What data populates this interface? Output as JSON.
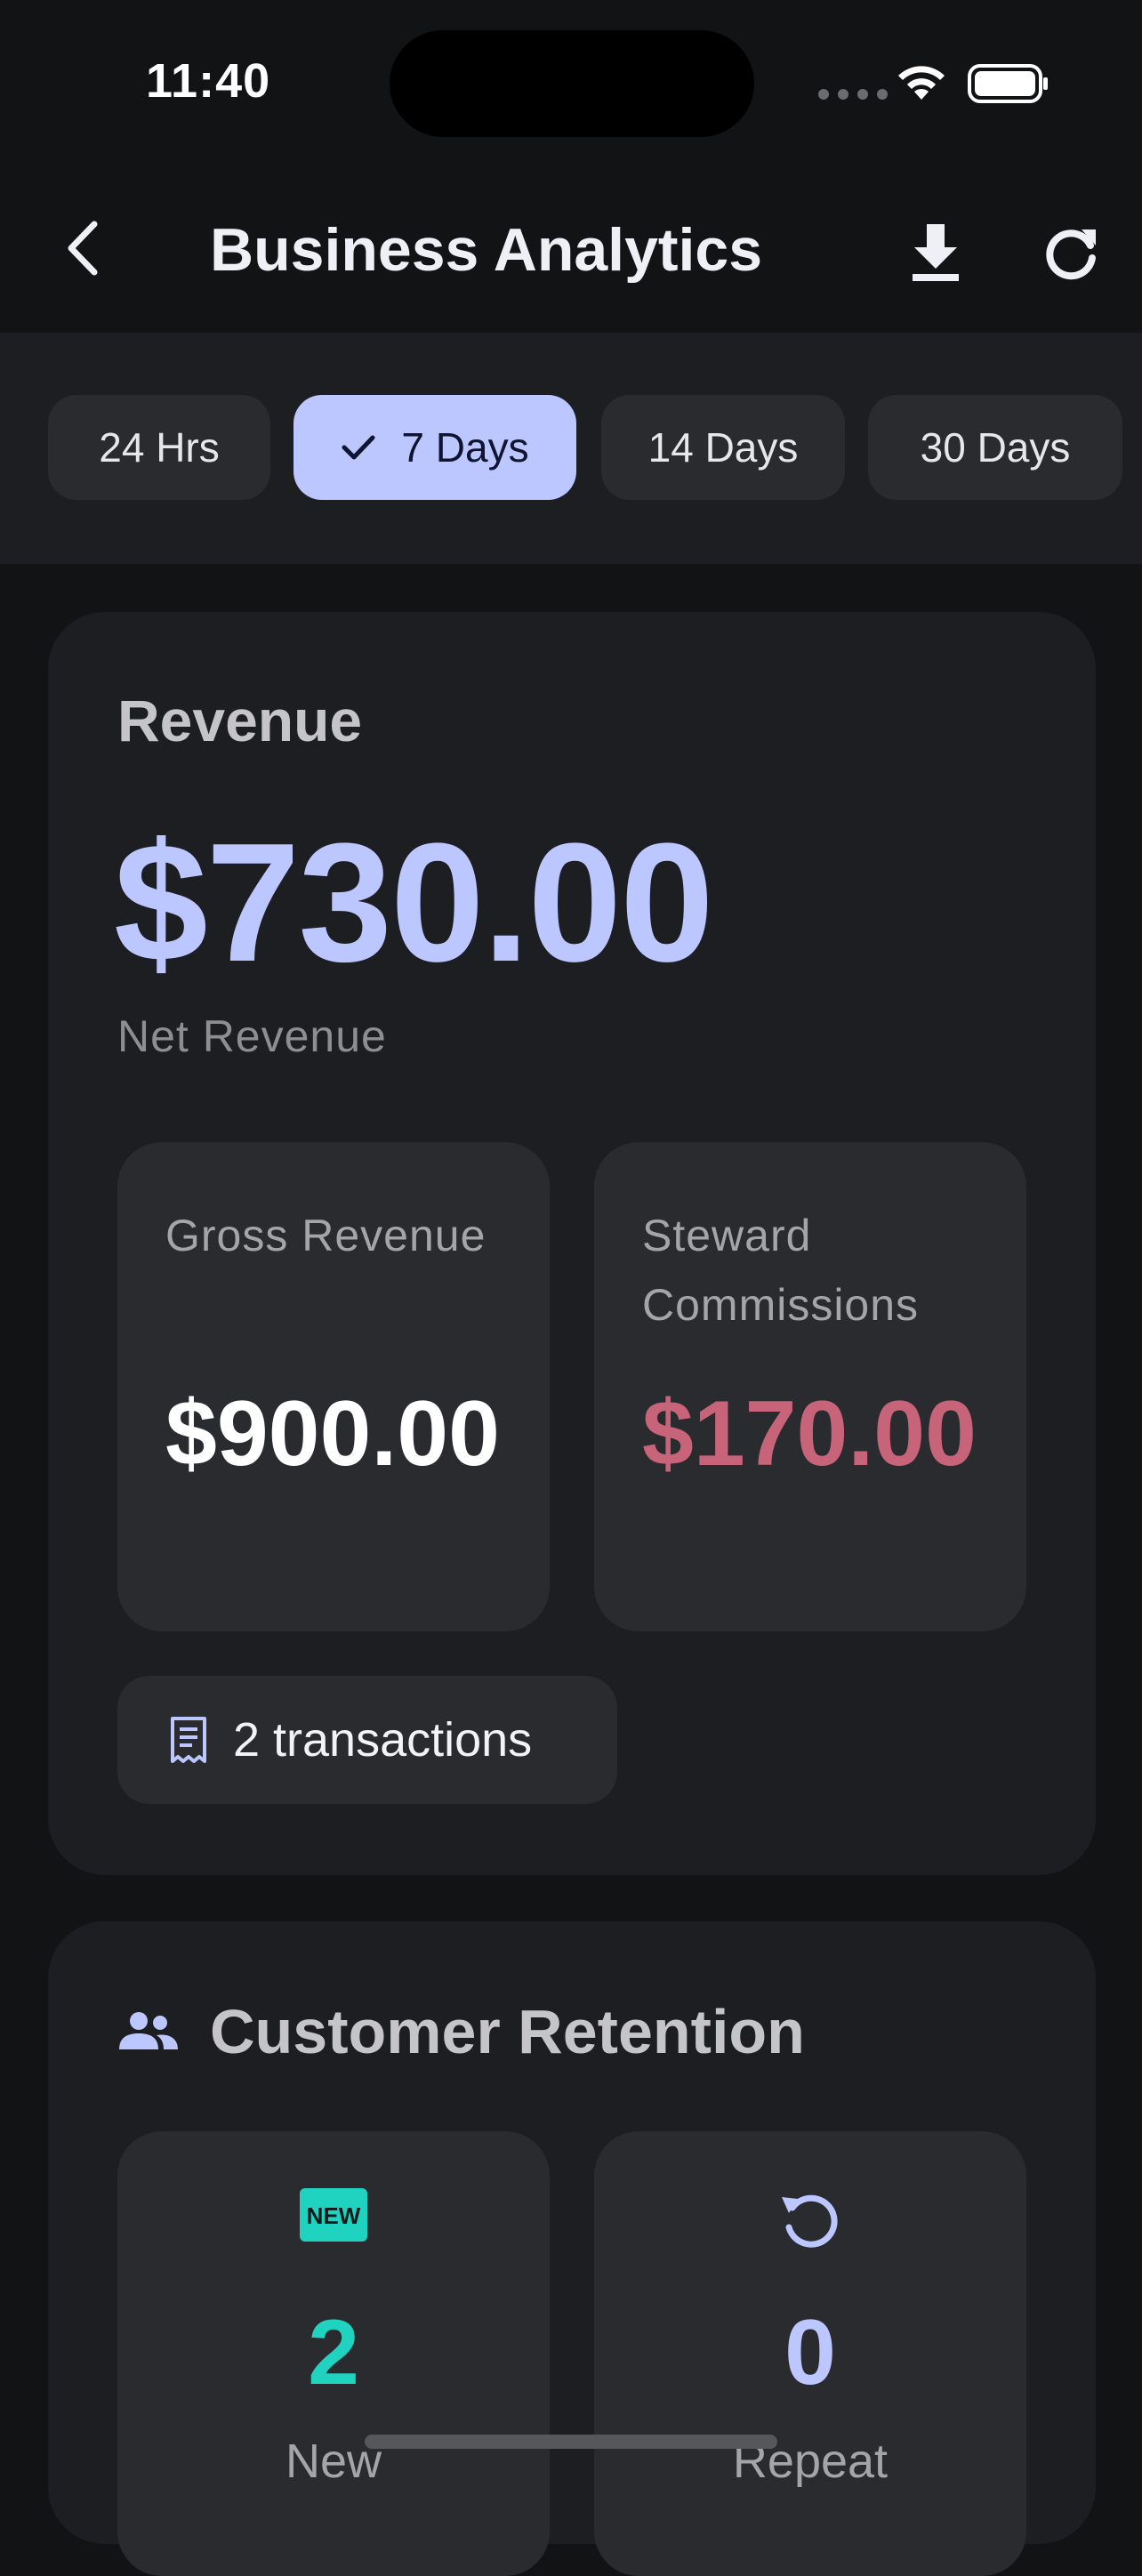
{
  "status": {
    "time": "11:40"
  },
  "header": {
    "title": "Business Analytics"
  },
  "filters": [
    {
      "label": "24 Hrs",
      "selected": false
    },
    {
      "label": "7 Days",
      "selected": true
    },
    {
      "label": "14 Days",
      "selected": false
    },
    {
      "label": "30 Days",
      "selected": false
    }
  ],
  "revenue": {
    "title": "Revenue",
    "net_amount": "$730.00",
    "net_label": "Net Revenue",
    "gross_label": "Gross Revenue",
    "gross_amount": "$900.00",
    "commission_label": "Steward Commissions",
    "commission_amount": "$170.00",
    "transactions": "2 transactions"
  },
  "retention": {
    "title": "Customer Retention",
    "new_count": "2",
    "new_label": "New",
    "new_badge": "NEW",
    "repeat_count": "0",
    "repeat_label": "Repeat"
  },
  "colors": {
    "accent": "#bcc7ff",
    "commission": "#c8647a",
    "new": "#1fd3c0"
  }
}
